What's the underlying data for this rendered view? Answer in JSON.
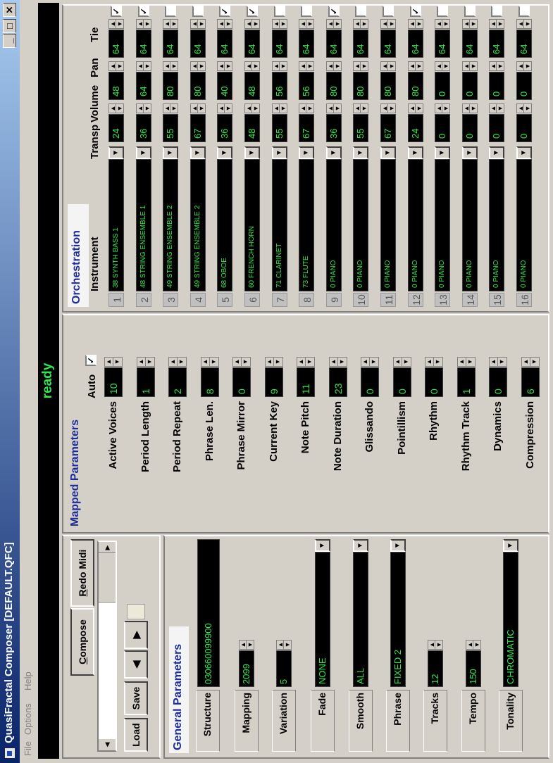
{
  "window": {
    "title": "QuasiFractal Composer [DEFAULT.QFC]"
  },
  "menu": [
    "File",
    "Options",
    "Help"
  ],
  "status": "ready",
  "controls": {
    "compose": "Compose",
    "redo_midi": "Redo Midi",
    "load": "Load",
    "save": "Save",
    "prev_glyph": "◀",
    "next_glyph": "▶"
  },
  "general": {
    "title": "General Parameters",
    "rows": [
      {
        "label": "Structure",
        "value": "030660099900",
        "kind": "text"
      },
      {
        "label": "Mapping",
        "value": "2099",
        "kind": "spin"
      },
      {
        "label": "Variation",
        "value": "5",
        "kind": "spin"
      },
      {
        "label": "Fade",
        "value": "NONE",
        "kind": "dropdown"
      },
      {
        "label": "Smooth",
        "value": "ALL",
        "kind": "dropdown"
      },
      {
        "label": "Phrase",
        "value": "FIXED 2",
        "kind": "dropdown"
      },
      {
        "label": "Tracks",
        "value": "12",
        "kind": "spin"
      },
      {
        "label": "Tempo",
        "value": "150",
        "kind": "spin"
      },
      {
        "label": "Tonality",
        "value": "CHROMATIC",
        "kind": "dropdown"
      }
    ]
  },
  "mapped": {
    "title": "Mapped Parameters",
    "auto_label": "Auto",
    "auto_checked": true,
    "rows": [
      {
        "label": "Active Voices",
        "value": "10"
      },
      {
        "label": "Period Length",
        "value": "1"
      },
      {
        "label": "Period Repeat",
        "value": "2"
      },
      {
        "label": "Phrase Len.",
        "value": "8"
      },
      {
        "label": "Phrase Mirror",
        "value": "0"
      },
      {
        "label": "Current Key",
        "value": "9"
      },
      {
        "label": "Note Pitch",
        "value": "11"
      },
      {
        "label": "Note Duration",
        "value": "23"
      },
      {
        "label": "Glissando",
        "value": "0"
      },
      {
        "label": "Pointillism",
        "value": "0"
      },
      {
        "label": "Rhythm",
        "value": "0"
      },
      {
        "label": "Rhythm Track",
        "value": "1"
      },
      {
        "label": "Dynamics",
        "value": "0"
      },
      {
        "label": "Compression",
        "value": "6"
      }
    ]
  },
  "orchestration": {
    "title": "Orchestration",
    "headers": {
      "instrument": "Instrument",
      "transp": "Transp",
      "volume": "Volume",
      "pan": "Pan",
      "tie": "Tie"
    },
    "tracks": [
      {
        "num": "1",
        "instrument": "38 SYNTH BASS 1",
        "transp": "24",
        "volume": "48",
        "pan": "64",
        "tie": true
      },
      {
        "num": "2",
        "instrument": "48 STRING ENSEMBLE 1",
        "transp": "36",
        "volume": "64",
        "pan": "64",
        "tie": true
      },
      {
        "num": "3",
        "instrument": "49 STRING ENSEMBLE 2",
        "transp": "55",
        "volume": "80",
        "pan": "64",
        "tie": false
      },
      {
        "num": "4",
        "instrument": "49 STRING ENSEMBLE 2",
        "transp": "67",
        "volume": "80",
        "pan": "64",
        "tie": false
      },
      {
        "num": "5",
        "instrument": "68 OBOE",
        "transp": "36",
        "volume": "40",
        "pan": "64",
        "tie": true
      },
      {
        "num": "6",
        "instrument": "60 FRENCH HORN",
        "transp": "48",
        "volume": "48",
        "pan": "64",
        "tie": true
      },
      {
        "num": "7",
        "instrument": "71 CLARINET",
        "transp": "55",
        "volume": "56",
        "pan": "64",
        "tie": false
      },
      {
        "num": "8",
        "instrument": "73 FLUTE",
        "transp": "67",
        "volume": "56",
        "pan": "64",
        "tie": false
      },
      {
        "num": "9",
        "instrument": "0 PIANO",
        "transp": "36",
        "volume": "80",
        "pan": "64",
        "tie": true
      },
      {
        "num": "10",
        "instrument": "0 PIANO",
        "transp": "55",
        "volume": "80",
        "pan": "64",
        "tie": false
      },
      {
        "num": "11",
        "instrument": "0 PIANO",
        "transp": "67",
        "volume": "80",
        "pan": "64",
        "tie": false
      },
      {
        "num": "12",
        "instrument": "0 PIANO",
        "transp": "24",
        "volume": "80",
        "pan": "64",
        "tie": true
      },
      {
        "num": "13",
        "instrument": "0 PIANO",
        "transp": "0",
        "volume": "0",
        "pan": "64",
        "tie": false
      },
      {
        "num": "14",
        "instrument": "0 PIANO",
        "transp": "0",
        "volume": "0",
        "pan": "64",
        "tie": false
      },
      {
        "num": "15",
        "instrument": "0 PIANO",
        "transp": "0",
        "volume": "0",
        "pan": "64",
        "tie": false
      },
      {
        "num": "16",
        "instrument": "0 PIANO",
        "transp": "0",
        "volume": "0",
        "pan": "64",
        "tie": false
      }
    ]
  }
}
